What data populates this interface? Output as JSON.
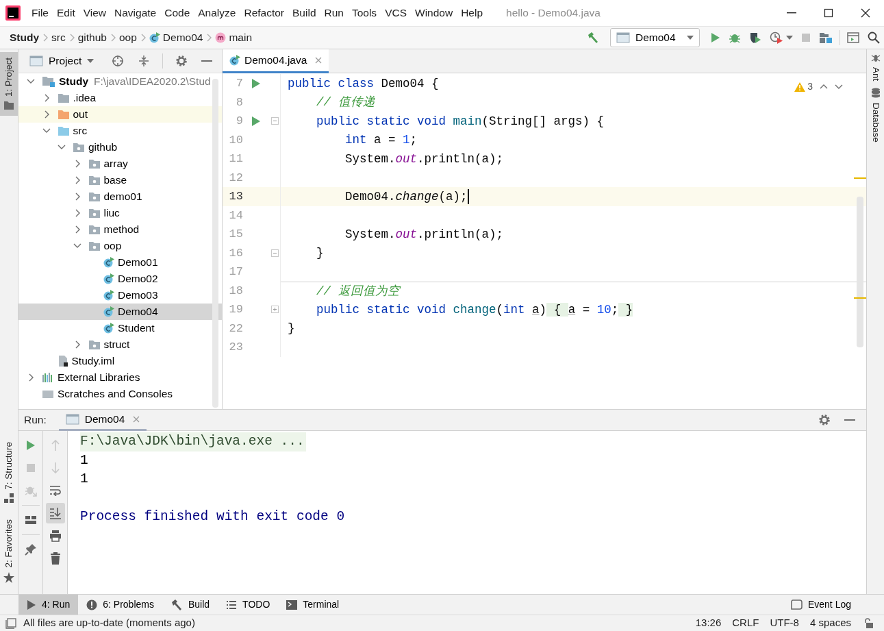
{
  "window": {
    "title": "hello - Demo04.java"
  },
  "menu": [
    "File",
    "Edit",
    "View",
    "Navigate",
    "Code",
    "Analyze",
    "Refactor",
    "Build",
    "Run",
    "Tools",
    "VCS",
    "Window",
    "Help"
  ],
  "breadcrumbs": [
    {
      "kind": "project",
      "text": "Study"
    },
    {
      "kind": "folder",
      "text": "src"
    },
    {
      "kind": "folder",
      "text": "github"
    },
    {
      "kind": "folder",
      "text": "oop"
    },
    {
      "kind": "class",
      "text": "Demo04"
    },
    {
      "kind": "method",
      "text": "main"
    }
  ],
  "toolbar": [
    {
      "kind": "build",
      "disabled": false
    },
    {
      "kind": "run-config",
      "label": "Demo04",
      "disabled": false
    },
    {
      "kind": "run",
      "disabled": false
    },
    {
      "kind": "debug",
      "disabled": false
    },
    {
      "kind": "coverage",
      "disabled": false
    },
    {
      "kind": "profile",
      "disabled": false
    },
    {
      "kind": "stop",
      "disabled": true
    },
    {
      "kind": "project-structure",
      "disabled": false
    },
    {
      "kind": "separator"
    },
    {
      "kind": "run-anything",
      "disabled": false
    },
    {
      "kind": "search",
      "disabled": false
    }
  ],
  "left_stripe": {
    "top": [
      {
        "kind": "project",
        "label": "1: Project",
        "selected": true
      }
    ],
    "bottom": [
      {
        "kind": "structure",
        "label": "7: Structure",
        "selected": false
      },
      {
        "kind": "favorites",
        "label": "2: Favorites",
        "selected": false
      }
    ]
  },
  "right_stripe": [
    {
      "kind": "ant",
      "label": "Ant",
      "selected": false
    },
    {
      "kind": "database",
      "label": "Database",
      "selected": false
    }
  ],
  "project_panel": {
    "title": "Project",
    "tree": [
      {
        "kind": "module",
        "label": "Study",
        "path": "F:\\java\\IDEA2020.2\\Stud",
        "expanded": true,
        "selected": false,
        "highlighted": false,
        "children": [
          {
            "kind": "folder",
            "label": ".idea",
            "expanded": false,
            "selected": false,
            "highlighted": false
          },
          {
            "kind": "excluded-folder",
            "label": "out",
            "expanded": false,
            "selected": false,
            "highlighted": true
          },
          {
            "kind": "source-folder",
            "label": "src",
            "expanded": true,
            "selected": false,
            "highlighted": false,
            "children": [
              {
                "kind": "package",
                "label": "github",
                "expanded": true,
                "selected": false,
                "highlighted": false,
                "children": [
                  {
                    "kind": "package",
                    "label": "array",
                    "expanded": false,
                    "selected": false,
                    "highlighted": false
                  },
                  {
                    "kind": "package",
                    "label": "base",
                    "expanded": false,
                    "selected": false,
                    "highlighted": false
                  },
                  {
                    "kind": "package",
                    "label": "demo01",
                    "expanded": false,
                    "selected": false,
                    "highlighted": false
                  },
                  {
                    "kind": "package",
                    "label": "liuc",
                    "expanded": false,
                    "selected": false,
                    "highlighted": false
                  },
                  {
                    "kind": "package",
                    "label": "method",
                    "expanded": false,
                    "selected": false,
                    "highlighted": false
                  },
                  {
                    "kind": "package",
                    "label": "oop",
                    "expanded": true,
                    "selected": false,
                    "highlighted": false,
                    "children": [
                      {
                        "kind": "class",
                        "label": "Demo01",
                        "selected": false,
                        "highlighted": false
                      },
                      {
                        "kind": "class",
                        "label": "Demo02",
                        "selected": false,
                        "highlighted": false
                      },
                      {
                        "kind": "class",
                        "label": "Demo03",
                        "selected": false,
                        "highlighted": false
                      },
                      {
                        "kind": "class",
                        "label": "Demo04",
                        "selected": true,
                        "highlighted": false
                      },
                      {
                        "kind": "class",
                        "label": "Student",
                        "selected": false,
                        "highlighted": false
                      }
                    ]
                  },
                  {
                    "kind": "package",
                    "label": "struct",
                    "expanded": false,
                    "selected": false,
                    "highlighted": false
                  }
                ]
              }
            ]
          },
          {
            "kind": "module-file",
            "label": "Study.iml",
            "selected": false,
            "highlighted": false
          }
        ]
      },
      {
        "kind": "libraries",
        "label": "External Libraries",
        "expanded": false,
        "selected": false,
        "highlighted": false
      },
      {
        "kind": "scratches",
        "label": "Scratches and Consoles",
        "selected": false,
        "highlighted": false
      }
    ]
  },
  "editor": {
    "tabs": [
      {
        "label": "Demo04.java",
        "selected": true
      }
    ],
    "warnings": "3",
    "lines": [
      {
        "number": "7",
        "kind": "plain",
        "run": true,
        "current": false,
        "separator_above": false,
        "tokens": [
          {
            "kind": "keyword",
            "text": "public class"
          },
          {
            "kind": "plain",
            "text": " Demo04 {"
          }
        ]
      },
      {
        "number": "8",
        "kind": "plain",
        "run": false,
        "current": false,
        "separator_above": false,
        "tokens": [
          {
            "kind": "comment",
            "text": "    // 值传递"
          }
        ]
      },
      {
        "number": "9",
        "kind": "fold-start",
        "run": true,
        "current": false,
        "separator_above": false,
        "tokens": [
          {
            "kind": "keyword",
            "text": "    public static void "
          },
          {
            "kind": "declaration",
            "text": "main"
          },
          {
            "kind": "plain",
            "text": "(String[] args) {"
          }
        ]
      },
      {
        "number": "10",
        "kind": "plain",
        "run": false,
        "current": false,
        "separator_above": false,
        "tokens": [
          {
            "kind": "keyword",
            "text": "        int"
          },
          {
            "kind": "plain",
            "text": " a = "
          },
          {
            "kind": "number",
            "text": "1"
          },
          {
            "kind": "plain",
            "text": ";"
          }
        ]
      },
      {
        "number": "11",
        "kind": "plain",
        "run": false,
        "current": false,
        "separator_above": false,
        "tokens": [
          {
            "kind": "plain",
            "text": "        System."
          },
          {
            "kind": "field",
            "text": "out"
          },
          {
            "kind": "plain",
            "text": ".println(a);"
          }
        ]
      },
      {
        "number": "12",
        "kind": "plain",
        "run": false,
        "current": false,
        "separator_above": false
      },
      {
        "number": "13",
        "kind": "plain",
        "run": false,
        "current": true,
        "separator_above": false,
        "tokens": [
          {
            "kind": "plain",
            "text": "        Demo04."
          },
          {
            "kind": "static-call",
            "text": "change"
          },
          {
            "kind": "plain",
            "text": "(a);"
          }
        ]
      },
      {
        "number": "14",
        "kind": "plain",
        "run": false,
        "current": false,
        "separator_above": false
      },
      {
        "number": "15",
        "kind": "plain",
        "run": false,
        "current": false,
        "separator_above": false,
        "tokens": [
          {
            "kind": "plain",
            "text": "        System."
          },
          {
            "kind": "field",
            "text": "out"
          },
          {
            "kind": "plain",
            "text": ".println(a);"
          }
        ]
      },
      {
        "number": "16",
        "kind": "fold-end",
        "run": false,
        "current": false,
        "separator_above": false,
        "tokens": [
          {
            "kind": "plain",
            "text": "    }"
          }
        ]
      },
      {
        "number": "17",
        "kind": "plain",
        "run": false,
        "current": false,
        "separator_above": false
      },
      {
        "number": "18",
        "kind": "plain",
        "run": false,
        "current": false,
        "separator_above": true,
        "tokens": [
          {
            "kind": "comment",
            "text": "    // 返回值为空"
          }
        ]
      },
      {
        "number": "19",
        "kind": "collapsed",
        "run": false,
        "current": false,
        "separator_above": false,
        "tokens": [
          {
            "kind": "keyword",
            "text": "    public static void "
          },
          {
            "kind": "declaration",
            "text": "change"
          },
          {
            "kind": "plain",
            "text": "("
          },
          {
            "kind": "keyword",
            "text": "int "
          },
          {
            "kind": "parameter",
            "text": "a"
          },
          {
            "kind": "plain",
            "text": ")"
          },
          {
            "kind": "folded",
            "text": " { "
          },
          {
            "kind": "parameter",
            "text": "a"
          },
          {
            "kind": "plain",
            "text": " = "
          },
          {
            "kind": "number",
            "text": "10"
          },
          {
            "kind": "plain",
            "text": ";"
          },
          {
            "kind": "folded",
            "text": " }"
          }
        ]
      },
      {
        "number": "22",
        "kind": "plain",
        "run": false,
        "current": false,
        "separator_above": false,
        "tokens": [
          {
            "kind": "plain",
            "text": "}"
          }
        ]
      },
      {
        "number": "23",
        "kind": "plain",
        "run": false,
        "current": false,
        "separator_above": false
      }
    ]
  },
  "run_panel": {
    "label": "Run:",
    "tabs": [
      {
        "label": "Demo04",
        "selected": true
      }
    ],
    "actions": [
      [
        {
          "kind": "rerun",
          "disabled": false,
          "on": false
        },
        {
          "kind": "stop",
          "disabled": true,
          "on": false
        },
        {
          "kind": "debug-rerun",
          "disabled": true,
          "on": false
        },
        {
          "kind": "layout",
          "disabled": false,
          "on": false
        },
        {
          "kind": "pin",
          "disabled": false,
          "on": false
        }
      ],
      [
        {
          "kind": "up",
          "disabled": true,
          "on": false
        },
        {
          "kind": "down",
          "disabled": true,
          "on": false
        },
        {
          "kind": "wrap",
          "disabled": false,
          "on": false
        },
        {
          "kind": "scroll-end",
          "disabled": false,
          "on": true
        },
        {
          "kind": "print",
          "disabled": false,
          "on": false
        },
        {
          "kind": "trash",
          "disabled": false,
          "on": false
        }
      ]
    ],
    "output": [
      {
        "kind": "command",
        "text": "F:\\Java\\JDK\\bin\\java.exe ..."
      },
      {
        "kind": "stdout",
        "text": "1"
      },
      {
        "kind": "stdout",
        "text": "1"
      },
      {
        "kind": "system",
        "text": "Process finished with exit code 0"
      }
    ]
  },
  "tool_windows": [
    {
      "kind": "run",
      "label": "4: Run",
      "selected": true
    },
    {
      "kind": "problems",
      "label": "6: Problems",
      "selected": false
    },
    {
      "kind": "build",
      "label": "Build",
      "selected": false
    },
    {
      "kind": "todo",
      "label": "TODO",
      "selected": false
    },
    {
      "kind": "terminal",
      "label": "Terminal",
      "selected": false
    }
  ],
  "event_log": {
    "label": "Event Log"
  },
  "status_bar": {
    "message": "All files are up-to-date (moments ago)",
    "items": [
      "13:26",
      "CRLF",
      "UTF-8",
      "4 spaces"
    ]
  }
}
